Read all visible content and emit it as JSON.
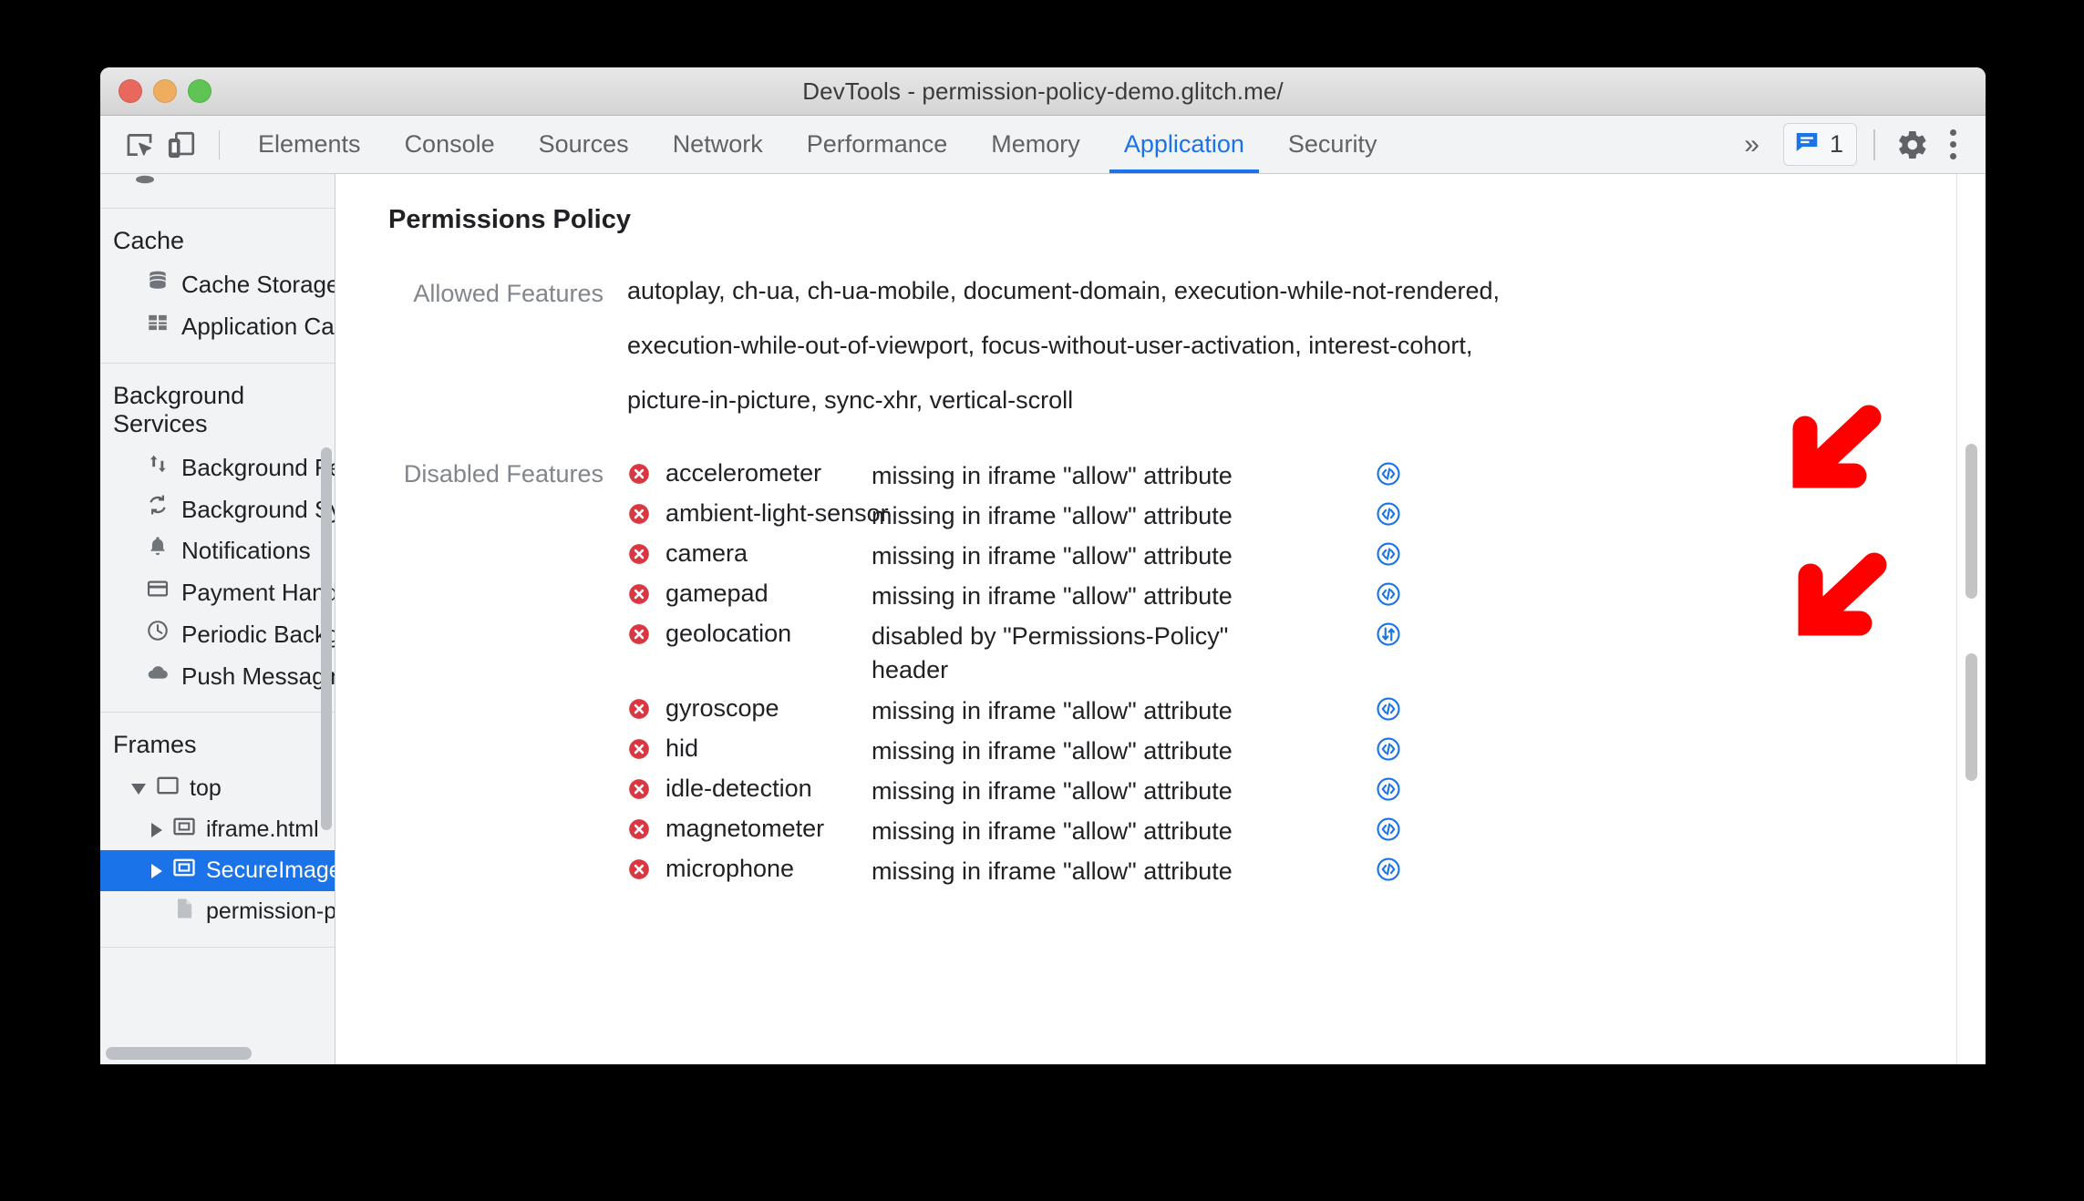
{
  "window": {
    "title": "DevTools - permission-policy-demo.glitch.me/",
    "traffic_lights": [
      "close-button",
      "minimize-button",
      "maximize-button"
    ]
  },
  "toolbar": {
    "inspect_icon": "inspect-element-icon",
    "device_icon": "device-toolbar-icon",
    "tabs": [
      {
        "label": "Elements",
        "active": false
      },
      {
        "label": "Console",
        "active": false
      },
      {
        "label": "Sources",
        "active": false
      },
      {
        "label": "Network",
        "active": false
      },
      {
        "label": "Performance",
        "active": false
      },
      {
        "label": "Memory",
        "active": false
      },
      {
        "label": "Application",
        "active": true
      },
      {
        "label": "Security",
        "active": false
      }
    ],
    "more_tabs_label": "»",
    "messages": {
      "icon": "message-icon",
      "count": "1"
    },
    "settings_icon": "gear-icon",
    "menu_icon": "kebab-menu-icon",
    "accent_color": "#1a73e8"
  },
  "sidebar": {
    "groups": [
      {
        "header": "Cache",
        "items": [
          {
            "label": "Cache Storage",
            "icon": "database-icon"
          },
          {
            "label": "Application Cache",
            "icon": "grid-icon"
          }
        ]
      },
      {
        "header": "Background Services",
        "items": [
          {
            "label": "Background Fetch",
            "icon": "up-down-arrows-icon"
          },
          {
            "label": "Background Sync",
            "icon": "sync-icon"
          },
          {
            "label": "Notifications",
            "icon": "bell-icon"
          },
          {
            "label": "Payment Handler",
            "icon": "credit-card-icon"
          },
          {
            "label": "Periodic Backgroun",
            "icon": "clock-icon"
          },
          {
            "label": "Push Messaging",
            "icon": "cloud-icon"
          }
        ]
      }
    ],
    "frames": {
      "header": "Frames",
      "tree": [
        {
          "label": "top",
          "icon": "frame-icon",
          "twisty": "expanded",
          "depth": 0,
          "selected": false
        },
        {
          "label": "iframe.html",
          "icon": "iframe-icon",
          "twisty": "collapsed",
          "depth": 1,
          "selected": false
        },
        {
          "label": "SecureImage",
          "icon": "iframe-icon",
          "twisty": "collapsed",
          "depth": 1,
          "selected": true
        },
        {
          "label": "permission-policy",
          "icon": "document-icon",
          "twisty": "none",
          "depth": 2,
          "selected": false
        }
      ],
      "selection_color": "#1a73e8"
    }
  },
  "main": {
    "title": "Permissions Policy",
    "allowed": {
      "label": "Allowed Features",
      "lines": [
        "autoplay, ch-ua, ch-ua-mobile, document-domain, execution-while-not-rendered,",
        "execution-while-out-of-viewport, focus-without-user-activation, interest-cohort,",
        "picture-in-picture, sync-xhr, vertical-scroll"
      ]
    },
    "disabled": {
      "label": "Disabled Features",
      "error_icon": "error-circle-icon",
      "error_color": "#d93025",
      "rows": [
        {
          "name": "accelerometer",
          "reason": "missing in iframe \"allow\" attribute",
          "action_icon": "code-icon",
          "tall": false
        },
        {
          "name": "ambient-light-sensor",
          "reason": "missing in iframe \"allow\" attribute",
          "action_icon": "code-icon",
          "tall": false
        },
        {
          "name": "camera",
          "reason": "missing in iframe \"allow\" attribute",
          "action_icon": "code-icon",
          "tall": false
        },
        {
          "name": "gamepad",
          "reason": "missing in iframe \"allow\" attribute",
          "action_icon": "code-icon",
          "tall": false
        },
        {
          "name": "geolocation",
          "reason": "disabled by \"Permissions-Policy\" header",
          "action_icon": "network-header-icon",
          "tall": true
        },
        {
          "name": "gyroscope",
          "reason": "missing in iframe \"allow\" attribute",
          "action_icon": "code-icon",
          "tall": false
        },
        {
          "name": "hid",
          "reason": "missing in iframe \"allow\" attribute",
          "action_icon": "code-icon",
          "tall": false
        },
        {
          "name": "idle-detection",
          "reason": "missing in iframe \"allow\" attribute",
          "action_icon": "code-icon",
          "tall": false
        },
        {
          "name": "magnetometer",
          "reason": "missing in iframe \"allow\" attribute",
          "action_icon": "code-icon",
          "tall": false
        },
        {
          "name": "microphone",
          "reason": "missing in iframe \"allow\" attribute",
          "action_icon": "code-icon",
          "tall": false
        }
      ]
    }
  },
  "annotations": {
    "color": "#ff0000",
    "arrows": [
      {
        "name": "arrow-pointing-accelerometer-code-icon",
        "direction": "down-left"
      },
      {
        "name": "arrow-pointing-geolocation-header-icon",
        "direction": "down-left"
      }
    ]
  }
}
